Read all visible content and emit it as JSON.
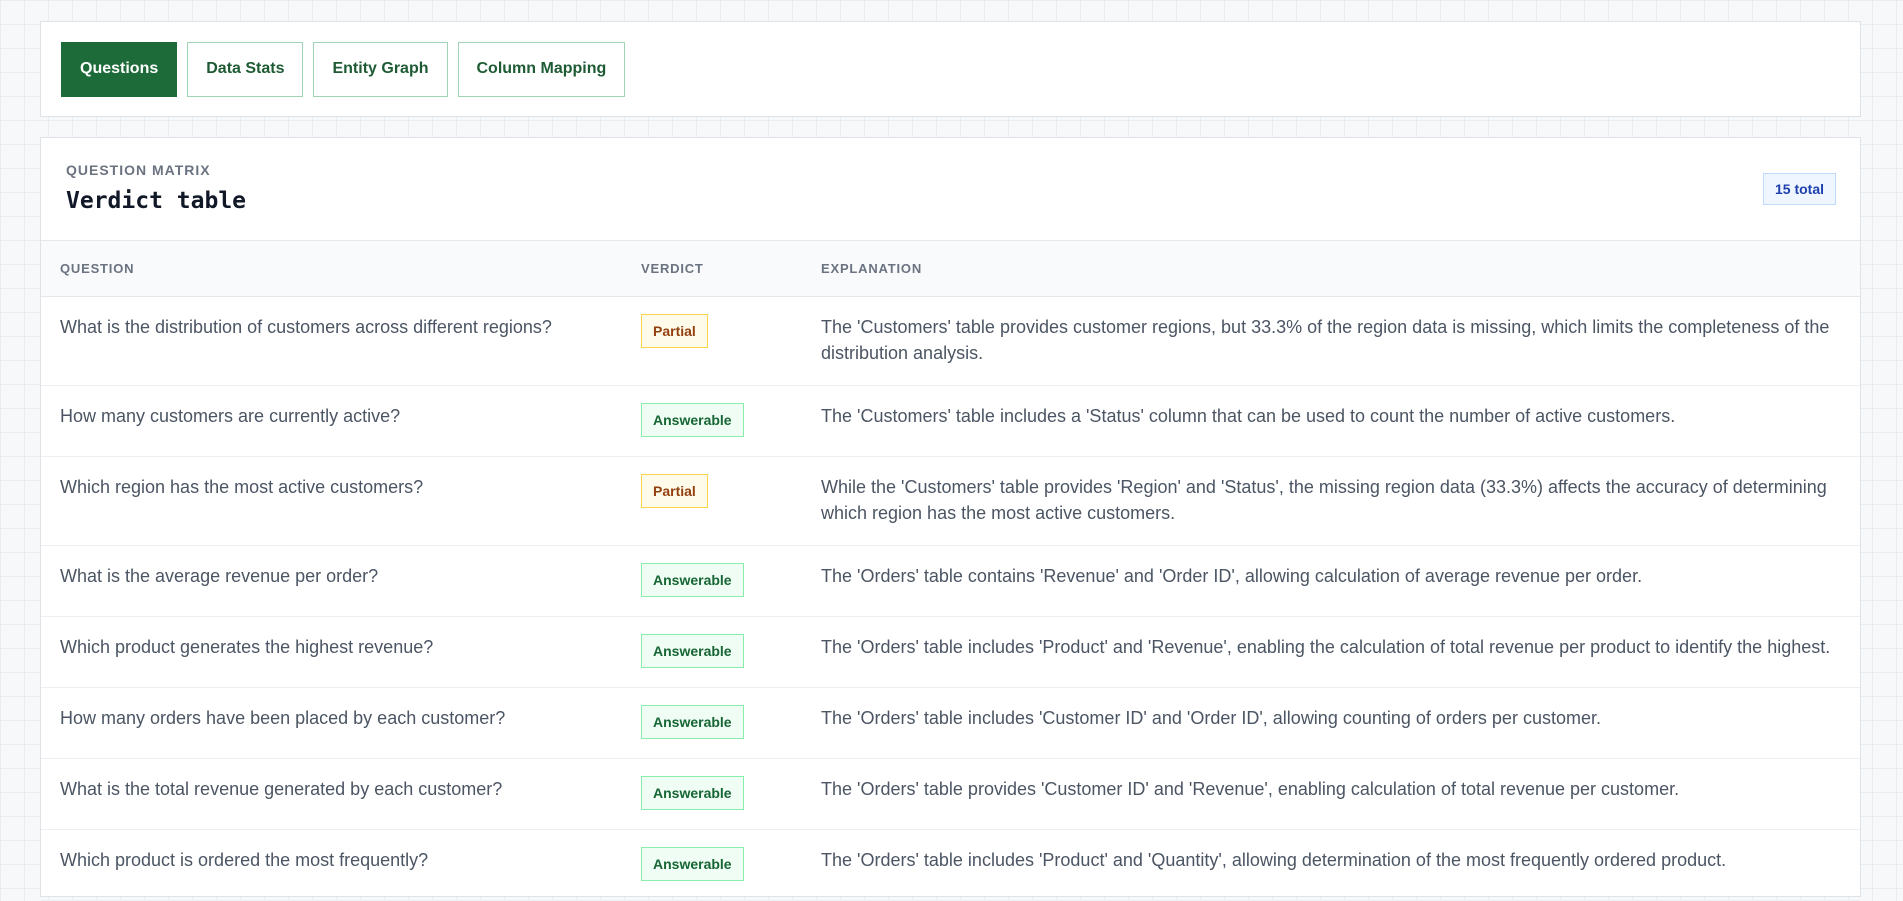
{
  "tabs": [
    {
      "label": "Questions",
      "active": true
    },
    {
      "label": "Data Stats",
      "active": false
    },
    {
      "label": "Entity Graph",
      "active": false
    },
    {
      "label": "Column Mapping",
      "active": false
    }
  ],
  "panel": {
    "eyebrow": "QUESTION MATRIX",
    "title": "Verdict table",
    "count_badge": "15 total"
  },
  "table": {
    "headers": [
      "QUESTION",
      "VERDICT",
      "EXPLANATION"
    ],
    "rows": [
      {
        "question": "What is the distribution of customers across different regions?",
        "verdict": "Partial",
        "verdict_type": "partial",
        "explanation": "The 'Customers' table provides customer regions, but 33.3% of the region data is missing, which limits the completeness of the distribution analysis."
      },
      {
        "question": "How many customers are currently active?",
        "verdict": "Answerable",
        "verdict_type": "answerable",
        "explanation": "The 'Customers' table includes a 'Status' column that can be used to count the number of active customers."
      },
      {
        "question": "Which region has the most active customers?",
        "verdict": "Partial",
        "verdict_type": "partial",
        "explanation": "While the 'Customers' table provides 'Region' and 'Status', the missing region data (33.3%) affects the accuracy of determining which region has the most active customers."
      },
      {
        "question": "What is the average revenue per order?",
        "verdict": "Answerable",
        "verdict_type": "answerable",
        "explanation": "The 'Orders' table contains 'Revenue' and 'Order ID', allowing calculation of average revenue per order."
      },
      {
        "question": "Which product generates the highest revenue?",
        "verdict": "Answerable",
        "verdict_type": "answerable",
        "explanation": "The 'Orders' table includes 'Product' and 'Revenue', enabling the calculation of total revenue per product to identify the highest."
      },
      {
        "question": "How many orders have been placed by each customer?",
        "verdict": "Answerable",
        "verdict_type": "answerable",
        "explanation": "The 'Orders' table includes 'Customer ID' and 'Order ID', allowing counting of orders per customer."
      },
      {
        "question": "What is the total revenue generated by each customer?",
        "verdict": "Answerable",
        "verdict_type": "answerable",
        "explanation": "The 'Orders' table provides 'Customer ID' and 'Revenue', enabling calculation of total revenue per customer."
      },
      {
        "question": "Which product is ordered the most frequently?",
        "verdict": "Answerable",
        "verdict_type": "answerable",
        "explanation": "The 'Orders' table includes 'Product' and 'Quantity', allowing determination of the most frequently ordered product."
      }
    ]
  },
  "colors": {
    "accent": "#1e6b3a",
    "partial": "#92400e",
    "answerable": "#166534"
  }
}
